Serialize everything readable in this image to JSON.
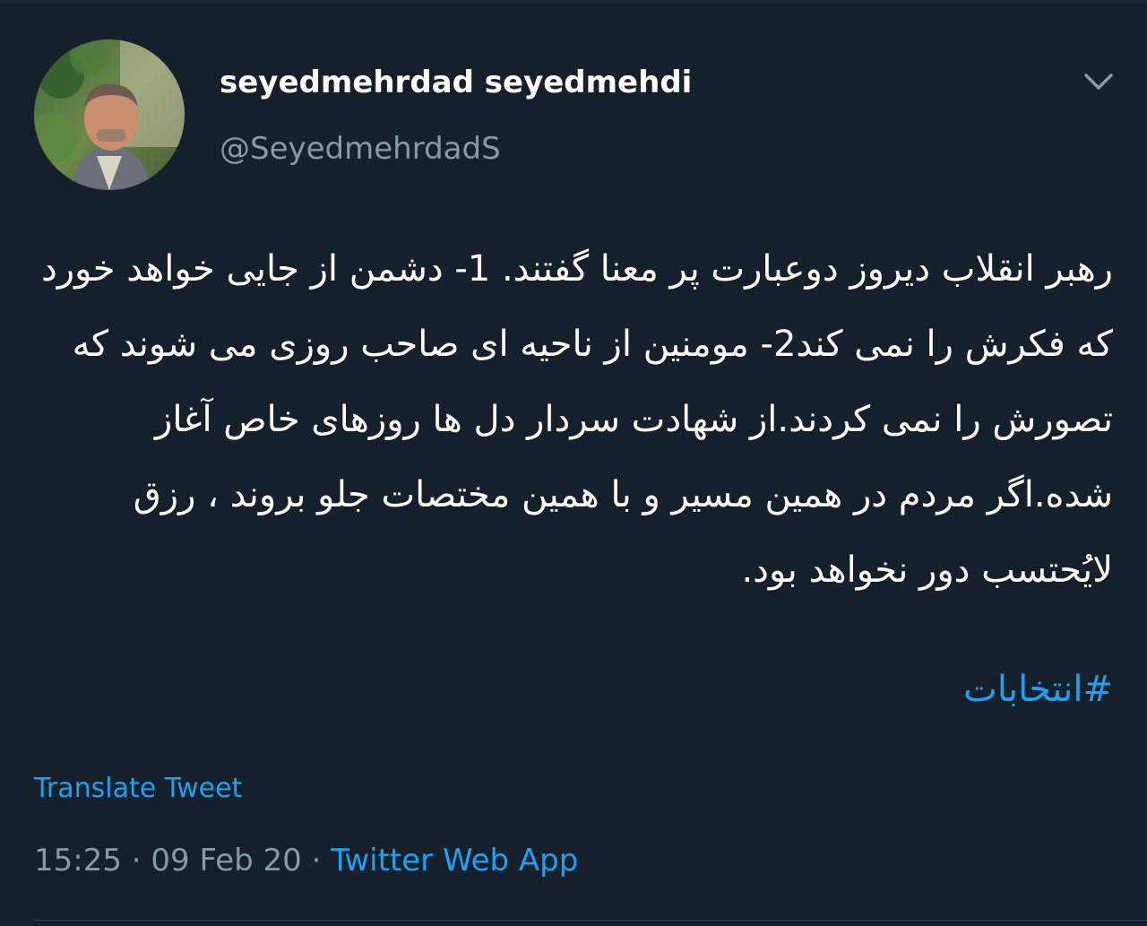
{
  "user": {
    "display_name": "seyedmehrdad seyedmehdi",
    "handle": "@SeyedmehrdadS"
  },
  "tweet": {
    "text": "رهبر انقلاب دیروز دوعبارت پر معنا گفتند. 1- دشمن از جایی خواهد خورد که فکرش را نمی کند2- مومنین از ناحیه ای صاحب روزی می شوند که تصورش را نمی کردند.از شهادت سردار دل ها روزهای خاص آغاز شده.اگر مردم در همین مسیر و با همین مختصات جلو بروند ، رزق لایُحتسب دور نخواهد بود.",
    "hashtag": "#انتخابات",
    "translate_label": "Translate Tweet",
    "time": "15:25",
    "date": "09 Feb 20",
    "separator": "·",
    "source": "Twitter Web App"
  },
  "icons": {
    "caret": "chevron-down-icon",
    "avatar": "profile-photo"
  },
  "colors": {
    "background": "#15202b",
    "accent": "#1da1f2",
    "secondary_text": "#8899a6",
    "primary_text": "#ffffff"
  }
}
